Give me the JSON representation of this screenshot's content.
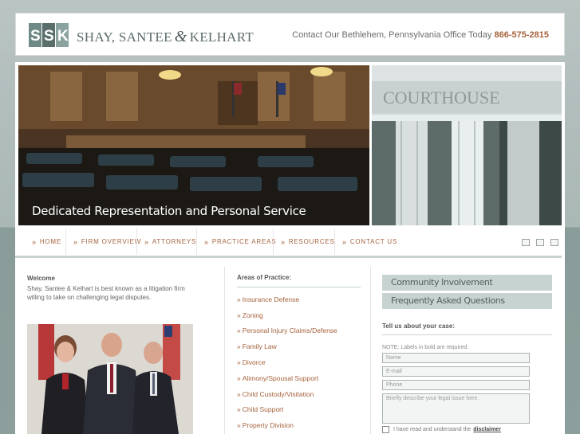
{
  "header": {
    "logo_text_left": "SHAY, SANTEE",
    "logo_amp": "&",
    "logo_text_right": "KELHART",
    "contact_text": "Contact Our Bethlehem, Pennsylvania Office Today",
    "phone": "866-575-2815"
  },
  "hero": {
    "tagline": "Dedicated Representation and Personal Service",
    "building_sign": "COURTHOUSE"
  },
  "nav": {
    "items": [
      {
        "label": "HOME"
      },
      {
        "label": "FIRM OVERVIEW"
      },
      {
        "label": "ATTORNEYS"
      },
      {
        "label": "PRACTICE AREAS"
      },
      {
        "label": "RESOURCES"
      },
      {
        "label": "CONTACT US"
      }
    ],
    "chevron": "»"
  },
  "welcome": {
    "title": "Welcome",
    "text": "Shay, Santee & Kelhart is best known as a litigation firm willing to take on challenging legal disputes."
  },
  "practice": {
    "title": "Areas of Practice:",
    "items": [
      "Insurance Defense",
      "Zoning",
      "Personal Injury Claims/Defense",
      "Family Law",
      "Divorce",
      "Alimony/Spousal Support",
      "Child Custody/Visitation",
      "Child Support",
      "Property Division"
    ]
  },
  "sidebar": {
    "buttons": [
      "Community Involvement",
      "Frequently Asked Questions"
    ]
  },
  "form": {
    "title": "Tell us about your case:",
    "note": "NOTE: Labels in bold are required.",
    "name_placeholder": "Name",
    "email_placeholder": "E-mail",
    "phone_placeholder": "Phone",
    "issue_placeholder": "Briefly describe your legal issue here.",
    "agree_text": "I have read and understand the",
    "agree_link": "disclaimer"
  },
  "colors": {
    "accent": "#a5623c",
    "panel_rule": "#c6d3d1",
    "background": "#a9b7b5"
  }
}
